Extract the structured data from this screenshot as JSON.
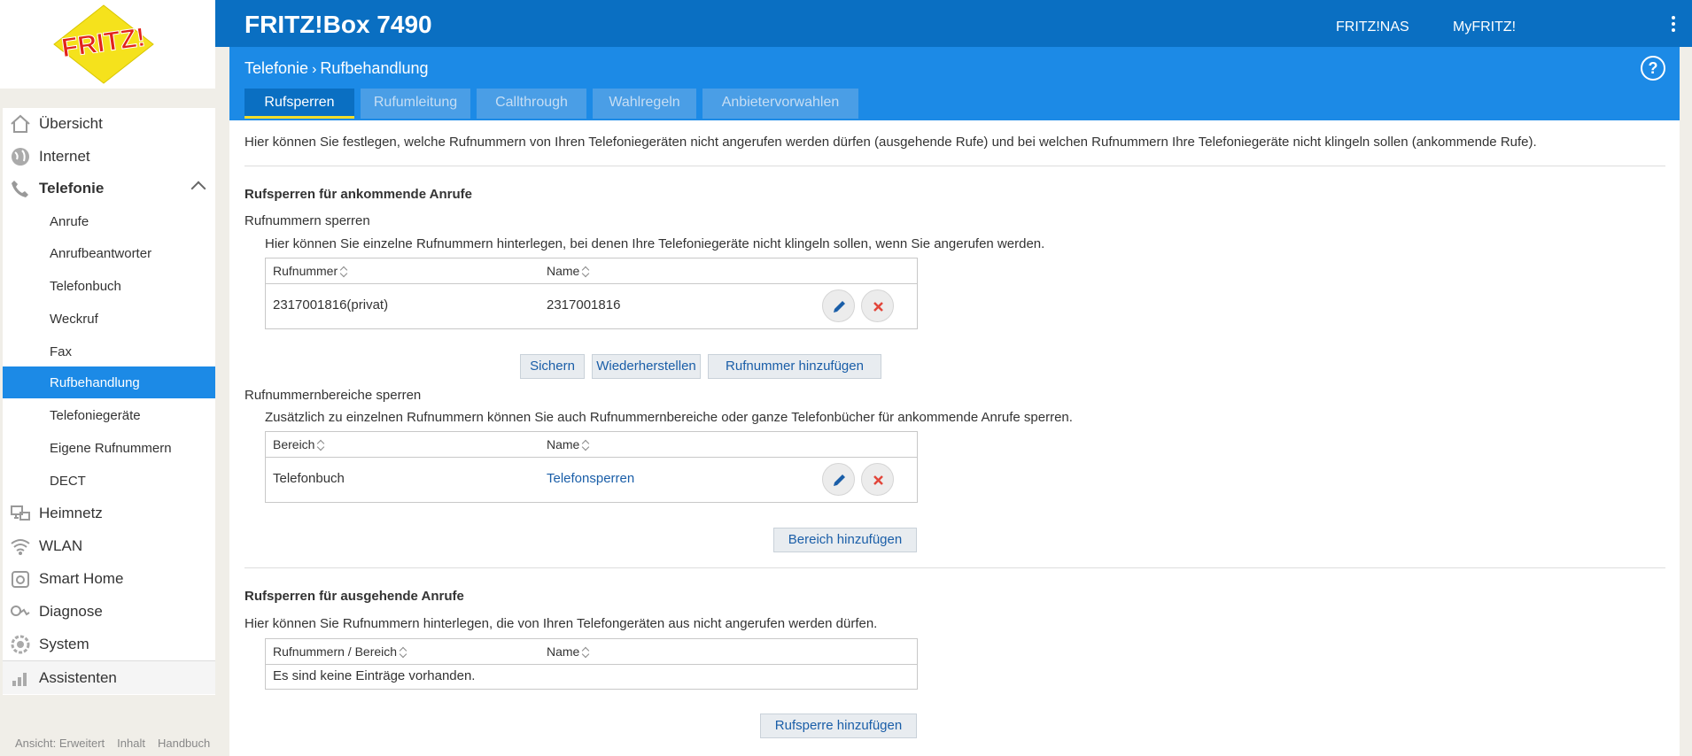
{
  "header": {
    "box_title": "FRITZ!Box 7490",
    "links": [
      "FRITZ!NAS",
      "MyFRITZ!"
    ],
    "logo_text": "FRITZ!"
  },
  "breadcrumb": {
    "parent": "Telefonie",
    "current": "Rufbehandlung"
  },
  "tabs": [
    {
      "label": "Rufsperren",
      "active": true
    },
    {
      "label": "Rufumleitung",
      "active": false
    },
    {
      "label": "Callthrough",
      "active": false
    },
    {
      "label": "Wahlregeln",
      "active": false
    },
    {
      "label": "Anbietervorwahlen",
      "active": false
    }
  ],
  "sidebar": {
    "items": [
      {
        "label": "Übersicht",
        "icon": "home-icon"
      },
      {
        "label": "Internet",
        "icon": "globe-icon"
      },
      {
        "label": "Telefonie",
        "icon": "phone-icon",
        "expanded": true
      },
      {
        "label": "Heimnetz",
        "icon": "network-icon"
      },
      {
        "label": "WLAN",
        "icon": "wifi-icon"
      },
      {
        "label": "Smart Home",
        "icon": "smart-home-icon"
      },
      {
        "label": "Diagnose",
        "icon": "diagnose-icon"
      },
      {
        "label": "System",
        "icon": "system-icon"
      },
      {
        "label": "Assistenten",
        "icon": "wizard-icon"
      }
    ],
    "sub_items": [
      {
        "label": "Anrufe",
        "active": false
      },
      {
        "label": "Anrufbeantworter",
        "active": false
      },
      {
        "label": "Telefonbuch",
        "active": false
      },
      {
        "label": "Weckruf",
        "active": false
      },
      {
        "label": "Fax",
        "active": false
      },
      {
        "label": "Rufbehandlung",
        "active": true
      },
      {
        "label": "Telefoniegeräte",
        "active": false
      },
      {
        "label": "Eigene Rufnummern",
        "active": false
      },
      {
        "label": "DECT",
        "active": false
      }
    ],
    "footer": [
      "Ansicht: Erweitert",
      "Inhalt",
      "Handbuch"
    ]
  },
  "main": {
    "intro": "Hier können Sie festlegen, welche Rufnummern von Ihren Telefoniegeräten nicht angerufen werden dürfen (ausgehende Rufe) und bei welchen Rufnummern Ihre Telefoniegeräte nicht klingeln sollen (ankommende Rufe).",
    "incoming": {
      "title": "Rufsperren für ankommende Anrufe",
      "numbers": {
        "subtitle": "Rufnummern sperren",
        "desc": "Hier können Sie einzelne Rufnummern hinterlegen, bei denen Ihre Telefoniegeräte nicht klingeln sollen, wenn Sie angerufen werden.",
        "col1": "Rufnummer",
        "col2": "Name",
        "rows": [
          {
            "number": "2317001816(privat)",
            "name": "2317001816"
          }
        ],
        "buttons": {
          "save": "Sichern",
          "restore": "Wiederherstellen",
          "add": "Rufnummer hinzufügen"
        }
      },
      "ranges": {
        "subtitle": "Rufnummernbereiche sperren",
        "desc": "Zusätzlich zu einzelnen Rufnummern können Sie auch Rufnummernbereiche oder ganze Telefonbücher für ankommende Anrufe sperren.",
        "col1": "Bereich",
        "col2": "Name",
        "rows": [
          {
            "range": "Telefonbuch",
            "name": "Telefonsperren"
          }
        ],
        "add": "Bereich hinzufügen"
      }
    },
    "outgoing": {
      "title": "Rufsperren für ausgehende Anrufe",
      "desc": "Hier können Sie Rufnummern hinterlegen, die von Ihren Telefongeräten aus nicht angerufen werden dürfen.",
      "col1": "Rufnummern / Bereich",
      "col2": "Name",
      "empty": "Es sind keine Einträge vorhanden.",
      "add": "Rufsperre hinzufügen"
    }
  },
  "colors": {
    "header_blue": "#0a6fc2",
    "sub_blue": "#1c8ae6",
    "tab_active_underline": "#f0dc2a",
    "link": "#1a5ea8"
  }
}
